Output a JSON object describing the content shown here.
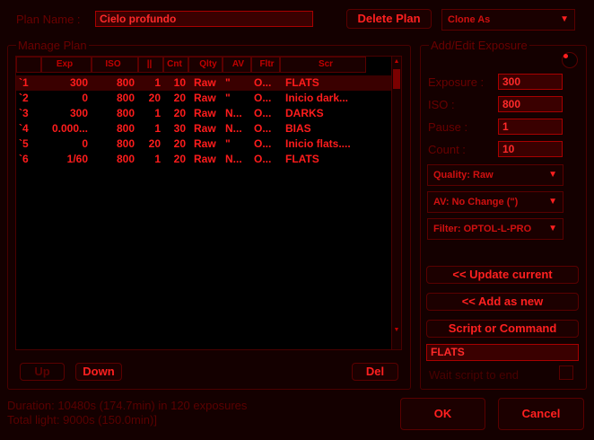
{
  "plan": {
    "name_label": "Plan Name :",
    "name_value": "Cielo profundo",
    "delete_label": "Delete Plan",
    "clone_label": "Clone As"
  },
  "manage": {
    "title": "Manage Plan",
    "columns": [
      "",
      "Exp",
      "ISO",
      "||",
      "Cnt",
      "Qlty",
      "AV",
      "Fltr",
      "Scr"
    ],
    "rows": [
      [
        "`1",
        "300",
        "800",
        "1",
        "10",
        "Raw",
        "\"",
        "O...",
        "FLATS"
      ],
      [
        "`2",
        "0",
        "800",
        "20",
        "20",
        "Raw",
        "\"",
        "O...",
        "Inicio dark..."
      ],
      [
        "`3",
        "300",
        "800",
        "1",
        "20",
        "Raw",
        "N...",
        "O...",
        "DARKS"
      ],
      [
        "`4",
        "0.000...",
        "800",
        "1",
        "30",
        "Raw",
        "N...",
        "O...",
        "BIAS"
      ],
      [
        "`5",
        "0",
        "800",
        "20",
        "20",
        "Raw",
        "\"",
        "O...",
        "Inicio flats...."
      ],
      [
        "`6",
        "1/60",
        "800",
        "1",
        "20",
        "Raw",
        "N...",
        "O...",
        "FLATS"
      ]
    ],
    "up_label": "Up",
    "down_label": "Down",
    "del_label": "Del"
  },
  "exposure": {
    "title": "Add/Edit Exposure",
    "exposure_label": "Exposure :",
    "exposure_value": "300",
    "iso_label": "ISO :",
    "iso_value": "800",
    "pause_label": "Pause :",
    "pause_value": "1",
    "count_label": "Count :",
    "count_value": "10",
    "quality": "Quality: Raw",
    "av": "AV: No Change (\")",
    "filter": "Filter: OPTOL-L-PRO",
    "update_label": "<< Update current",
    "add_label": "<< Add as new",
    "script_label": "Script or Command",
    "script_value": "FLATS",
    "wait_label": "Wait script to end"
  },
  "status": {
    "duration": "Duration: 10480s (174.7min) in 120 exposures",
    "total": "Total light: 9000s (150.0min)]"
  },
  "footer": {
    "ok_label": "OK",
    "cancel_label": "Cancel"
  }
}
